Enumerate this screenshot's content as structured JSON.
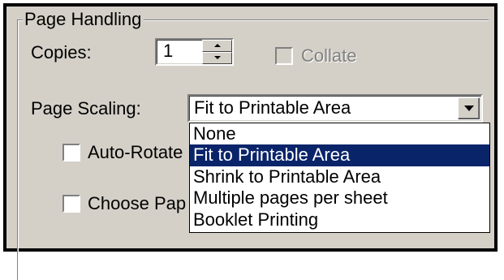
{
  "group": {
    "title": "Page Handling"
  },
  "copies": {
    "label": "Copies:",
    "value": "1"
  },
  "collate": {
    "label": "Collate",
    "checked": false,
    "enabled": false
  },
  "page_scaling": {
    "label": "Page Scaling:",
    "selected": "Fit to Printable Area",
    "options": [
      "None",
      "Fit to Printable Area",
      "Shrink to Printable Area",
      "Multiple pages per sheet",
      "Booklet Printing"
    ],
    "highlighted_index": 1
  },
  "auto_rotate": {
    "label": "Auto-Rotate",
    "checked": false
  },
  "choose_paper": {
    "label": "Choose Pap",
    "checked": false
  },
  "colors": {
    "face": "#d4d0c8",
    "highlight": "#0a246a"
  }
}
